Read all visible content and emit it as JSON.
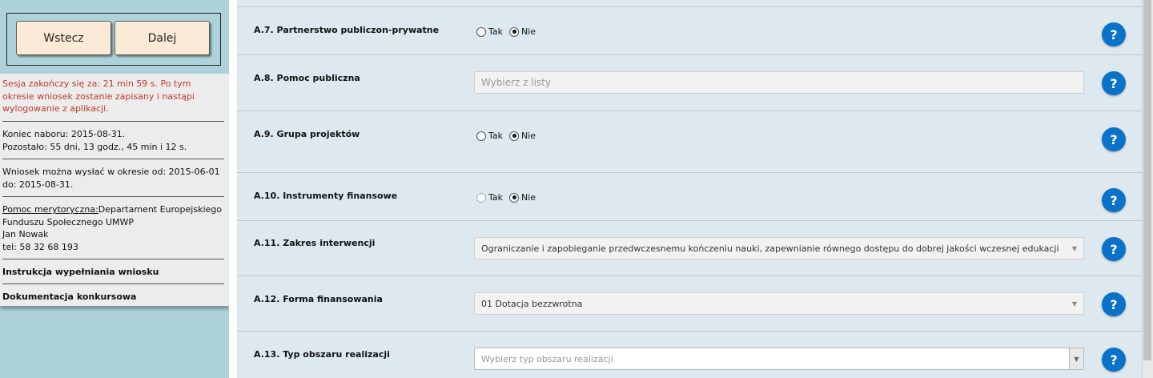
{
  "nav": {
    "back_label": "Wstecz",
    "next_label": "Dalej"
  },
  "info": {
    "session_text": "Sesja zakończy się za: 21 min 59 s. Po tym okresie wniosek zostanie zapisany i nastąpi wylogowanie z aplikacji.",
    "deadline_line1": "Koniec naboru: 2015-08-31.",
    "deadline_line2": "Pozostało: 55 dni, 13 godz., 45 min i 12 s.",
    "window_line1": "Wniosek można wysłać w okresie od: 2015-06-01",
    "window_line2": "do: 2015-08-31.",
    "help_label": "Pomoc merytoryczna:",
    "help_dept": "Departament Europejskiego Funduszu Społecznego UMWP",
    "help_person": "Jan Nowak",
    "help_phone": "tel: 58 32 68 193",
    "instructions_link": "Instrukcja wypełniania wniosku",
    "docs_link": "Dokumentacja konkursowa"
  },
  "form": {
    "help_glyph": "?",
    "radio_yes": "Tak",
    "radio_no": "Nie",
    "rows": [
      {
        "label": "A.7. Partnerstwo publiczon-prywatne",
        "type": "radio",
        "selected": "Nie"
      },
      {
        "label": "A.8. Pomoc publiczna",
        "type": "select",
        "placeholder": "Wybierz z listy"
      },
      {
        "label": "A.9. Grupa projektów",
        "type": "radio",
        "selected": "Nie"
      },
      {
        "label": "A.10. Instrumenty finansowe",
        "type": "radio",
        "selected": "Nie",
        "yes_disabled": true
      },
      {
        "label": "A.11. Zakres interwencji",
        "type": "select",
        "value": "Ograniczanie i zapobieganie przedwczesnemu kończeniu nauki, zapewnianie równego dostępu do dobrej jakości wczesnej edukacji"
      },
      {
        "label": "A.12. Forma finansowania",
        "type": "select",
        "value": "01 Dotacja bezzwrotna"
      },
      {
        "label": "A.13. Typ obszaru realizacji",
        "type": "select",
        "placeholder": "Wybierz typ obszaru realizacji"
      }
    ]
  }
}
